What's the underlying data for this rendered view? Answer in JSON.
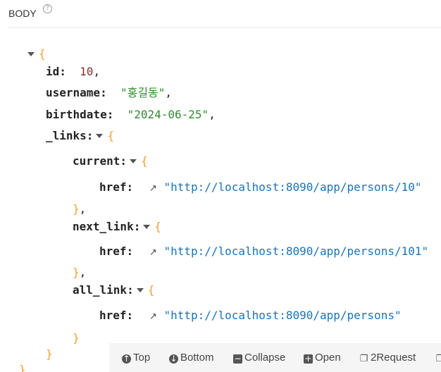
{
  "header": {
    "title": "BODY",
    "help": "?"
  },
  "json": {
    "open_brace": "{",
    "close_brace": "}",
    "close_brace_comma": "},",
    "id": {
      "key": "id:",
      "value": "10",
      "comma": ","
    },
    "username": {
      "key": "username:",
      "value": "\"홍길동\"",
      "comma": ","
    },
    "birthdate": {
      "key": "birthdate:",
      "value": "\"2024-06-25\"",
      "comma": ","
    },
    "links": {
      "key": "_links:"
    },
    "current": {
      "key": "current:",
      "href_key": "href:",
      "href": "\"http://localhost:8090/app/persons/10\""
    },
    "next_link": {
      "key": "next_link:",
      "href_key": "href:",
      "href": "\"http://localhost:8090/app/persons/101\""
    },
    "all_link": {
      "key": "all_link:",
      "href_key": "href:",
      "href": "\"http://localhost:8090/app/persons\""
    }
  },
  "toolbar": {
    "top": "Top",
    "bottom": "Bottom",
    "collapse": "Collapse",
    "open": "Open",
    "request": "2Request"
  }
}
